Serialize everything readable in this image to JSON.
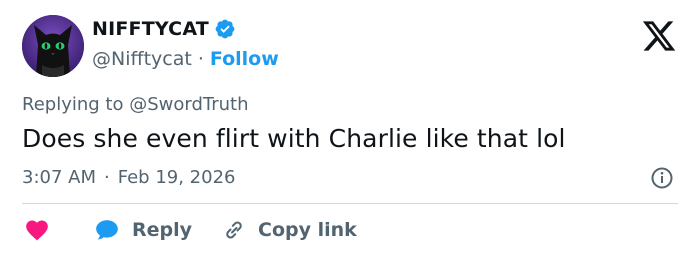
{
  "user": {
    "display_name": "NIFFTYCAT",
    "handle": "@Nifftycat",
    "separator": "·",
    "follow_label": "Follow"
  },
  "tweet": {
    "replying_prefix": "Replying to",
    "replying_to": "@SwordTruth",
    "text": "Does she even flirt with Charlie like that lol",
    "time": "3:07 AM",
    "date": "Feb 19, 2026",
    "meta_separator": "·"
  },
  "actions": {
    "reply_label": "Reply",
    "copy_link_label": "Copy link"
  },
  "icons": {
    "verified": "verified-badge-icon",
    "x_logo": "x-logo-icon",
    "info": "info-icon",
    "heart": "heart-icon",
    "reply": "reply-bubble-icon",
    "link": "link-icon"
  },
  "colors": {
    "accent": "#1d9bf0",
    "heart": "#f91880",
    "text_primary": "#0f1419",
    "text_secondary": "#536471",
    "divider": "#cfd9de"
  }
}
